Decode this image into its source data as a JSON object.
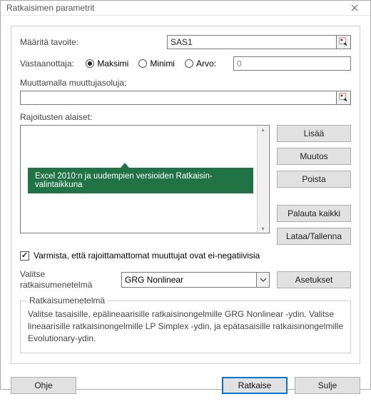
{
  "titlebar": {
    "title": "Ratkaisimen parametrit"
  },
  "objective": {
    "label": "Määritä tavoite:",
    "value": "SAS1"
  },
  "to": {
    "label": "Vastaanottaja:",
    "max": "Maksimi",
    "min": "Minimi",
    "value_label": "Arvo:",
    "value": "0"
  },
  "changing": {
    "label": "Muuttamalla muuttujasoluja:",
    "value": ""
  },
  "constraints": {
    "label": "Rajoitusten alaiset:",
    "tooltip": "Excel 2010:n ja uudempien versioiden Ratkaisin-valintaikkuna"
  },
  "buttons": {
    "add": "Lisää",
    "change": "Muutos",
    "delete": "Poista",
    "reset": "Palauta kaikki",
    "loadsave": "Lataa/Tallenna",
    "options": "Asetukset"
  },
  "nonneg": {
    "label": "Varmista, että rajoittamattomat muuttujat ovat ei-negatiivisia"
  },
  "method": {
    "label": "Valitse ratkaisumenetelmä",
    "selected": "GRG Nonlinear"
  },
  "methodbox": {
    "legend": "Ratkaisumenetelmä",
    "desc": "Valitse tasaisille, epälineaarisille ratkaisinongelmille GRG Nonlinear -ydin. Valitse lineaarisille ratkaisinongelmille LP Simplex -ydin, ja epätasaisille ratkaisinongelmille Evolutionary-ydin."
  },
  "footer": {
    "help": "Ohje",
    "solve": "Ratkaise",
    "close": "Sulje"
  }
}
